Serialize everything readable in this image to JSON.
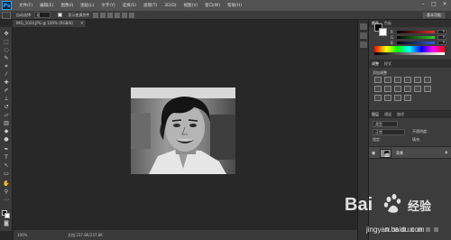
{
  "app": {
    "logo": "Ps",
    "menus": [
      "文件(F)",
      "编辑(E)",
      "图像(I)",
      "图层(L)",
      "文字(Y)",
      "选择(S)",
      "滤镜(T)",
      "3D(D)",
      "视图(V)",
      "窗口(W)",
      "帮助(H)"
    ],
    "window_controls": [
      "–",
      "□",
      "×"
    ]
  },
  "options_bar": {
    "size_label": "自动选择:",
    "size_value": "组",
    "transform_label": "显示变换控件",
    "workspace": "基本功能"
  },
  "document": {
    "tab_title": "IMG_1024.JPG @ 100% (RGB/8)",
    "close": "×"
  },
  "status_bar": {
    "zoom": "100%",
    "doc_info": "文档:237.8K/237.8K"
  },
  "color_panel": {
    "tabs": [
      "颜色",
      "色板"
    ],
    "sliders": [
      {
        "label": "R",
        "value": "0",
        "color": "#d83a3a"
      },
      {
        "label": "G",
        "value": "0",
        "color": "#3ac23a"
      },
      {
        "label": "B",
        "value": "0",
        "color": "#3a6ad8"
      }
    ]
  },
  "adjustments_panel": {
    "tabs": [
      "调整",
      "样式"
    ],
    "title": "添加调整"
  },
  "layers_panel": {
    "tabs": [
      "图层",
      "通道",
      "路径"
    ],
    "filter": "类型",
    "mode": "正常",
    "opacity_label": "不透明度:",
    "lock_label": "锁定:",
    "fill_label": "填充:",
    "layer": {
      "name": "背景",
      "visible_icon": "eye-icon",
      "lock_icon": "lock-icon"
    }
  },
  "watermark": {
    "brand": "Bai",
    "brand_text": "经验",
    "url": "jingyan.baidu.com"
  }
}
